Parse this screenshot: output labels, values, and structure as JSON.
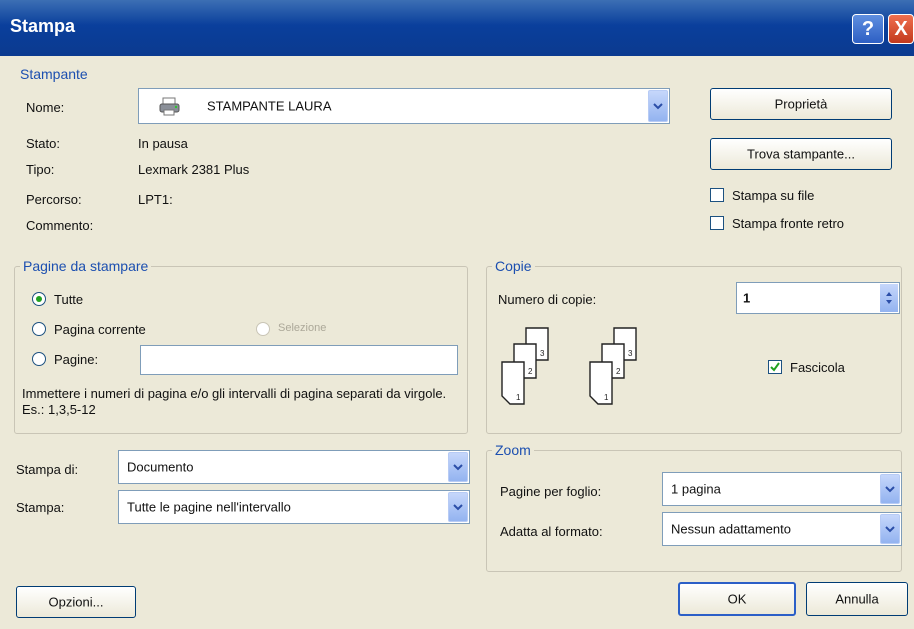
{
  "window": {
    "title": "Stampa",
    "help": "?",
    "close": "X"
  },
  "printer": {
    "group_title": "Stampante",
    "name_label": "Nome:",
    "name_value": "STAMPANTE LAURA",
    "status_label": "Stato:",
    "status_value": "In pausa",
    "type_label": "Tipo:",
    "type_value": "Lexmark 2381 Plus",
    "path_label": "Percorso:",
    "path_value": "LPT1:",
    "comment_label": "Commento:",
    "properties_button": "Proprietà",
    "find_button": "Trova stampante...",
    "print_to_file": "Stampa su file",
    "duplex": "Stampa fronte retro"
  },
  "pages": {
    "group_title": "Pagine da stampare",
    "all": "Tutte",
    "current": "Pagina corrente",
    "selection": "Selezione",
    "pages": "Pagine:",
    "pages_value": "",
    "hint": "Immettere i numeri di pagina e/o gli intervalli di pagina separati da virgole. Es.: 1,3,5-12"
  },
  "copies": {
    "group_title": "Copie",
    "number_label": "Numero di copie:",
    "number_value": "1",
    "collate": "Fascicola",
    "collate_checked": true,
    "icon_stack_a": [
      "3",
      "2",
      "1"
    ],
    "icon_stack_b": [
      "3",
      "2",
      "1"
    ]
  },
  "print_what": {
    "label": "Stampa di:",
    "value": "Documento"
  },
  "print_range": {
    "label": "Stampa:",
    "value": "Tutte le pagine nell'intervallo"
  },
  "zoom": {
    "group_title": "Zoom",
    "pages_per_sheet_label": "Pagine per foglio:",
    "pages_per_sheet_value": "1 pagina",
    "scale_label": "Adatta al formato:",
    "scale_value": "Nessun adattamento"
  },
  "footer": {
    "options_button": "Opzioni...",
    "ok_button": "OK",
    "cancel_button": "Annulla"
  },
  "colors": {
    "title_bar": "#0b3a8f",
    "group_title": "#1c4fb0",
    "dialog_bg": "#ece9d8"
  }
}
